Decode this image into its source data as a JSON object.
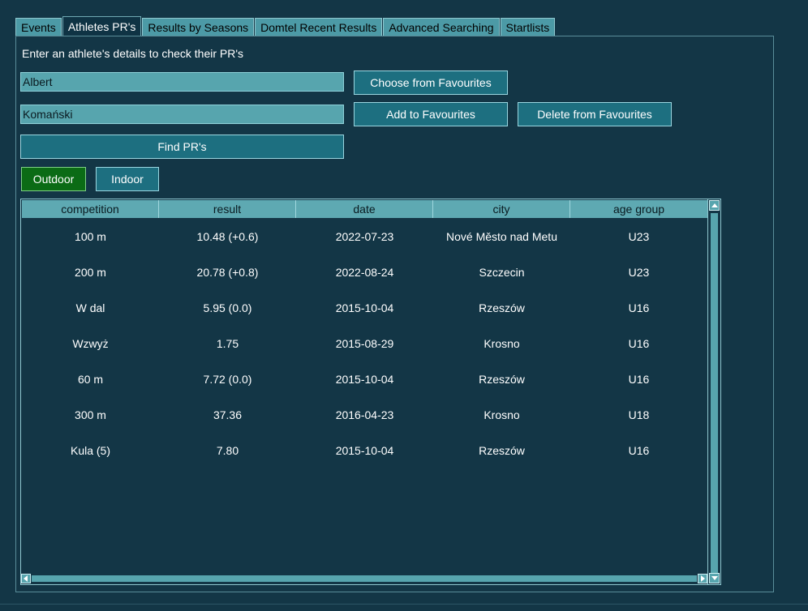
{
  "tabs": [
    {
      "label": "Events"
    },
    {
      "label": "Athletes PR's"
    },
    {
      "label": "Results by Seasons"
    },
    {
      "label": "Domtel Recent Results"
    },
    {
      "label": "Advanced Searching"
    },
    {
      "label": "Startlists"
    }
  ],
  "active_tab": "Athletes PR's",
  "form": {
    "instruction": "Enter an athlete's details to check their PR's",
    "first_name": "Albert",
    "last_name": "Komański",
    "choose_favourites_label": "Choose from Favourites",
    "add_favourites_label": "Add to Favourites",
    "delete_favourites_label": "Delete from Favourites",
    "find_label": "Find PR's",
    "outdoor_label": "Outdoor",
    "indoor_label": "Indoor"
  },
  "table": {
    "columns": [
      "competition",
      "result",
      "date",
      "city",
      "age group"
    ],
    "rows": [
      [
        "100 m",
        "10.48 (+0.6)",
        "2022-07-23",
        "Nové Město nad Metu",
        "U23"
      ],
      [
        "200 m",
        "20.78 (+0.8)",
        "2022-08-24",
        "Szczecin",
        "U23"
      ],
      [
        "W dal",
        "5.95 (0.0)",
        "2015-10-04",
        "Rzeszów",
        "U16"
      ],
      [
        "Wzwyż",
        "1.75",
        "2015-08-29",
        "Krosno",
        "U16"
      ],
      [
        "60 m",
        "7.72 (0.0)",
        "2015-10-04",
        "Rzeszów",
        "U16"
      ],
      [
        "300 m",
        "37.36",
        "2016-04-23",
        "Krosno",
        "U18"
      ],
      [
        "Kula (5)",
        "7.80",
        "2015-10-04",
        "Rzeszów",
        "U16"
      ]
    ]
  },
  "colors": {
    "background": "#133646",
    "tab_inactive": "#4c9aa6",
    "field": "#57a5ae",
    "button": "#1d6f80",
    "selected_toggle": "#0b6b15"
  }
}
